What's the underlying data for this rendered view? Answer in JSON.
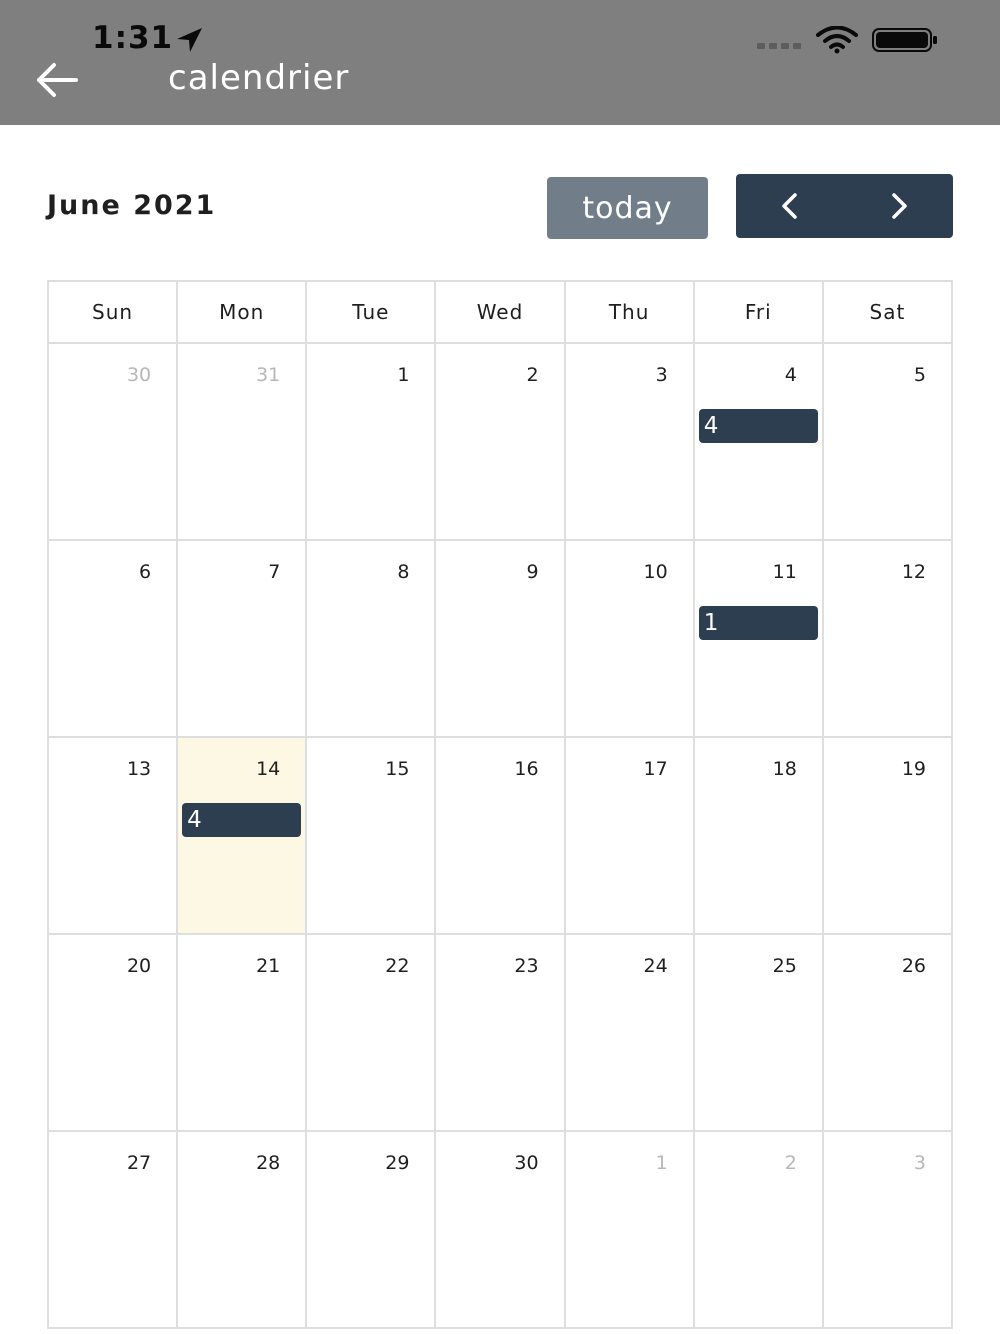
{
  "status_bar": {
    "time": "1:31"
  },
  "app_bar": {
    "title": "calendrier"
  },
  "toolbar": {
    "title": "June 2021",
    "today_label": "today"
  },
  "weekdays": [
    "Sun",
    "Mon",
    "Tue",
    "Wed",
    "Thu",
    "Fri",
    "Sat"
  ],
  "weeks": [
    [
      {
        "day": "30",
        "other": true
      },
      {
        "day": "31",
        "other": true
      },
      {
        "day": "1"
      },
      {
        "day": "2"
      },
      {
        "day": "3"
      },
      {
        "day": "4",
        "event": "4"
      },
      {
        "day": "5"
      }
    ],
    [
      {
        "day": "6"
      },
      {
        "day": "7"
      },
      {
        "day": "8"
      },
      {
        "day": "9"
      },
      {
        "day": "10"
      },
      {
        "day": "11",
        "event": "1"
      },
      {
        "day": "12"
      }
    ],
    [
      {
        "day": "13"
      },
      {
        "day": "14",
        "today": true,
        "event": "4"
      },
      {
        "day": "15"
      },
      {
        "day": "16"
      },
      {
        "day": "17"
      },
      {
        "day": "18"
      },
      {
        "day": "19"
      }
    ],
    [
      {
        "day": "20"
      },
      {
        "day": "21"
      },
      {
        "day": "22"
      },
      {
        "day": "23"
      },
      {
        "day": "24"
      },
      {
        "day": "25"
      },
      {
        "day": "26"
      }
    ],
    [
      {
        "day": "27"
      },
      {
        "day": "28"
      },
      {
        "day": "29"
      },
      {
        "day": "30"
      },
      {
        "day": "1",
        "other": true
      },
      {
        "day": "2",
        "other": true
      },
      {
        "day": "3",
        "other": true
      }
    ]
  ],
  "colors": {
    "app_bar": "#7f7f7f",
    "accent": "#2c3e50",
    "today_button": "#727d8a",
    "today_highlight": "#fcf8e3"
  },
  "icons": {
    "back": "arrow-left-icon",
    "prev": "chevron-left-icon",
    "next": "chevron-right-icon"
  }
}
